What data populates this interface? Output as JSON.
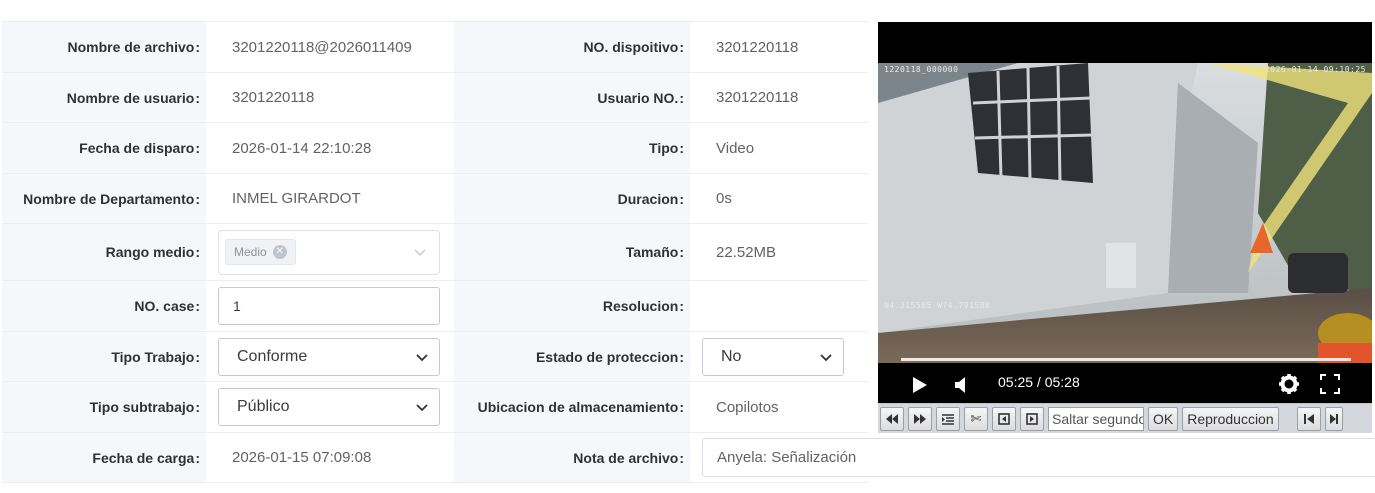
{
  "form": {
    "left_rows": [
      {
        "label": "Nombre de archivo",
        "value": "3201220118@2026011409"
      },
      {
        "label": "Nombre de usuario",
        "value": "3201220118"
      },
      {
        "label": "Fecha de disparo",
        "value": "2026-01-14 22:10:28"
      },
      {
        "label": "Nombre de Departamento",
        "value": "INMEL GIRARDOT"
      },
      {
        "label": "Rango medio",
        "tag": "Medio"
      },
      {
        "label": "NO. case",
        "value": "1"
      },
      {
        "label": "Tipo Trabajo",
        "value": "Conforme"
      },
      {
        "label": "Tipo subtrabajo",
        "value": "Público"
      },
      {
        "label": "Fecha de carga",
        "value": "2026-01-15 07:09:08"
      }
    ],
    "right_rows": [
      {
        "label": "NO. dispoitivo",
        "value": "3201220118"
      },
      {
        "label": "Usuario NO.",
        "value": "3201220118"
      },
      {
        "label": "Tipo",
        "value": "Video"
      },
      {
        "label": "Duracion",
        "value": "0s"
      },
      {
        "label": "Tamaño",
        "value": "22.52MB"
      },
      {
        "label": "Resolucion",
        "value": ""
      },
      {
        "label": "Estado de proteccion",
        "value": "No"
      },
      {
        "label": "Ubicacion de almacenamiento",
        "value": "Copilotos"
      },
      {
        "label": "Nota de archivo",
        "value": "Anyela: Señalización"
      }
    ],
    "colon": ":"
  },
  "player": {
    "osd_top_left": "1220118_000000",
    "osd_top_right": "2026-01-14 09:10:25",
    "osd_bottom_left": "N4.315585 W74.791588",
    "time": "05:25 / 05:28",
    "progress": 0.99
  },
  "toolbar": {
    "seek_placeholder": "Saltar segundos",
    "ok_label": "OK",
    "playback_label": "Reproduccion"
  },
  "colors": {
    "label_bg": "#f5f7fa",
    "border": "#ebeef5",
    "text": "#606266",
    "player_bg": "#000000"
  }
}
